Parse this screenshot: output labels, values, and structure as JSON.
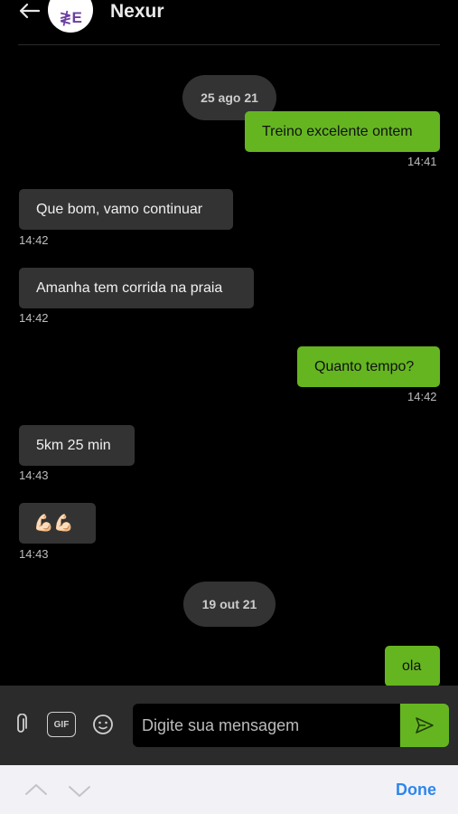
{
  "header": {
    "back_icon": "arrow-left-icon",
    "avatar_text": "≹E",
    "contact_name": "Nexur"
  },
  "chat": {
    "date_separators": [
      "25 ago 21",
      "19 out 21"
    ],
    "messages": [
      {
        "direction": "out",
        "text": "Treino excelente ontem",
        "time": "14:41"
      },
      {
        "direction": "in",
        "text": "Que bom, vamo continuar",
        "time": "14:42"
      },
      {
        "direction": "in",
        "text": "Amanha tem corrida na praia",
        "time": "14:42"
      },
      {
        "direction": "out",
        "text": "Quanto tempo?",
        "time": "14:42"
      },
      {
        "direction": "in",
        "text": "5km 25 min",
        "time": "14:43"
      },
      {
        "direction": "in",
        "text": "💪🏻💪🏻",
        "time": "14:43"
      },
      {
        "direction": "out",
        "text": "ola",
        "time": ""
      }
    ]
  },
  "composer": {
    "attach_icon": "paperclip-icon",
    "gif_label": "GIF",
    "emoji_icon": "smiley-icon",
    "placeholder": "Digite sua mensagem",
    "value": "",
    "send_icon": "send-icon"
  },
  "keyboard_bar": {
    "up_icon": "chevron-up-icon",
    "down_icon": "chevron-down-icon",
    "done_label": "Done"
  },
  "colors": {
    "outgoing_bubble": "#65b521",
    "incoming_bubble": "#333333",
    "background": "#000000",
    "done_link": "#2f86ea"
  }
}
